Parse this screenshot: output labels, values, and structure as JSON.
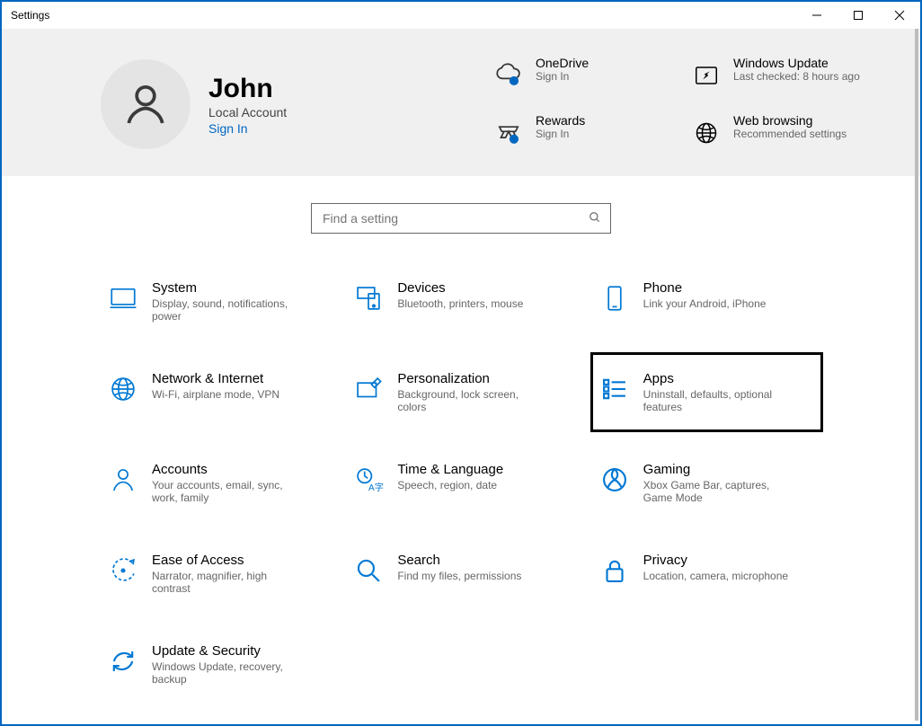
{
  "window": {
    "title": "Settings"
  },
  "profile": {
    "name": "John",
    "sub": "Local Account",
    "signin": "Sign In"
  },
  "header_links": [
    {
      "id": "onedrive",
      "title": "OneDrive",
      "sub": "Sign In"
    },
    {
      "id": "windows-update",
      "title": "Windows Update",
      "sub": "Last checked: 8 hours ago"
    },
    {
      "id": "rewards",
      "title": "Rewards",
      "sub": "Sign In"
    },
    {
      "id": "web-browsing",
      "title": "Web browsing",
      "sub": "Recommended settings"
    }
  ],
  "search": {
    "placeholder": "Find a setting"
  },
  "categories": [
    {
      "id": "system",
      "title": "System",
      "sub": "Display, sound, notifications, power"
    },
    {
      "id": "devices",
      "title": "Devices",
      "sub": "Bluetooth, printers, mouse"
    },
    {
      "id": "phone",
      "title": "Phone",
      "sub": "Link your Android, iPhone"
    },
    {
      "id": "network",
      "title": "Network & Internet",
      "sub": "Wi-Fi, airplane mode, VPN"
    },
    {
      "id": "personalization",
      "title": "Personalization",
      "sub": "Background, lock screen, colors"
    },
    {
      "id": "apps",
      "title": "Apps",
      "sub": "Uninstall, defaults, optional features",
      "highlighted": true
    },
    {
      "id": "accounts",
      "title": "Accounts",
      "sub": "Your accounts, email, sync, work, family"
    },
    {
      "id": "time-language",
      "title": "Time & Language",
      "sub": "Speech, region, date"
    },
    {
      "id": "gaming",
      "title": "Gaming",
      "sub": "Xbox Game Bar, captures, Game Mode"
    },
    {
      "id": "ease-of-access",
      "title": "Ease of Access",
      "sub": "Narrator, magnifier, high contrast"
    },
    {
      "id": "search",
      "title": "Search",
      "sub": "Find my files, permissions"
    },
    {
      "id": "privacy",
      "title": "Privacy",
      "sub": "Location, camera, microphone"
    },
    {
      "id": "update-security",
      "title": "Update & Security",
      "sub": "Windows Update, recovery, backup"
    }
  ]
}
